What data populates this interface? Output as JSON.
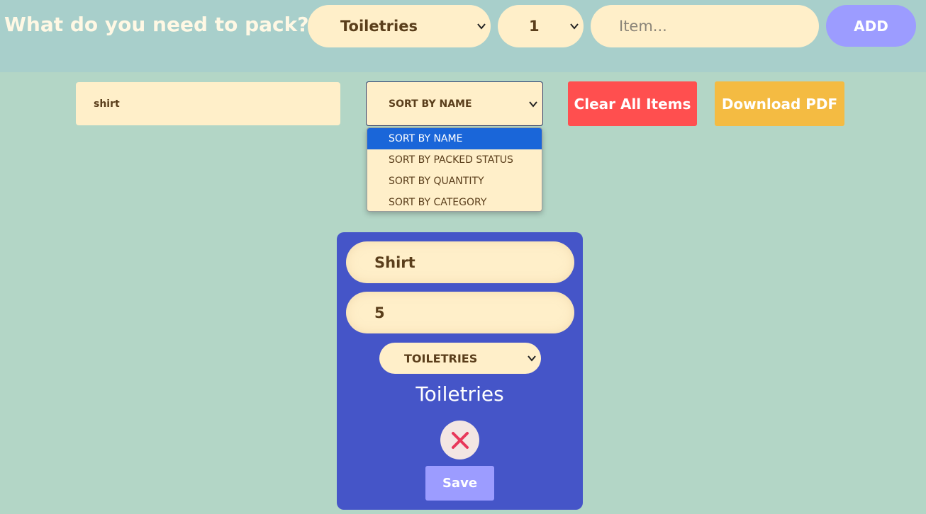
{
  "header": {
    "title": "What do you need to pack?",
    "category_select": {
      "value": "Toiletries",
      "icon": "chevron-down-icon"
    },
    "quantity_select": {
      "value": "1",
      "icon": "chevron-down-icon"
    },
    "item_input": {
      "placeholder": "Item..."
    },
    "add_label": "ADD"
  },
  "toolbar": {
    "search_value": "shirt",
    "sort_select": {
      "value": "SORT BY NAME",
      "icon": "chevron-down-icon"
    },
    "sort_options": [
      "SORT BY NAME",
      "SORT BY PACKED STATUS",
      "SORT BY QUANTITY",
      "SORT BY CATEGORY"
    ],
    "clear_label": "Clear All Items",
    "pdf_label": "Download PDF"
  },
  "card": {
    "name_value": "Shirt",
    "quantity_value": "5",
    "category_select": {
      "value": "TOILETRIES",
      "icon": "chevron-down-icon"
    },
    "category_label": "Toiletries",
    "delete_icon": "close-icon",
    "save_label": "Save"
  },
  "colors": {
    "background": "#b3d6c6",
    "header": "#a8cfcb",
    "field": "#ffefc9",
    "add": "#9c9cff",
    "clear": "#ff4f4f",
    "pdf": "#f4bb42",
    "card": "#4555c8",
    "selected_option": "#1a66d9",
    "delete_x": "#e8385a"
  }
}
